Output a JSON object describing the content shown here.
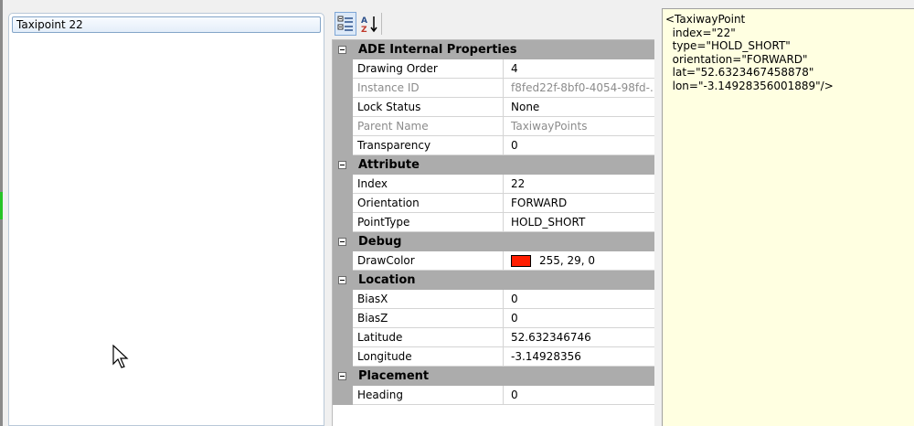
{
  "left_panel": {
    "selected_item": "Taxipoint 22"
  },
  "toolbar": {
    "categorized_icon": "categorized-icon",
    "alphabetical_icon": "sort-az-icon",
    "alpha_label_a": "A",
    "alpha_label_z": "Z"
  },
  "property_grid": {
    "categories": [
      {
        "name": "ADE Internal Properties",
        "rows": [
          {
            "key": "Drawing Order",
            "value": "4",
            "readonly": false
          },
          {
            "key": "Instance ID",
            "value": "f8fed22f-8bf0-4054-98fd-...",
            "readonly": true
          },
          {
            "key": "Lock Status",
            "value": "None",
            "readonly": false
          },
          {
            "key": "Parent Name",
            "value": "TaxiwayPoints",
            "readonly": true
          },
          {
            "key": "Transparency",
            "value": "0",
            "readonly": false
          }
        ]
      },
      {
        "name": "Attribute",
        "rows": [
          {
            "key": "Index",
            "value": "22",
            "readonly": false
          },
          {
            "key": "Orientation",
            "value": "FORWARD",
            "readonly": false
          },
          {
            "key": "PointType",
            "value": "HOLD_SHORT",
            "readonly": false
          }
        ]
      },
      {
        "name": "Debug",
        "rows": [
          {
            "key": "DrawColor",
            "value": "255, 29, 0",
            "readonly": false,
            "swatch": "#ff1d00"
          }
        ]
      },
      {
        "name": "Location",
        "rows": [
          {
            "key": "BiasX",
            "value": "0",
            "readonly": false
          },
          {
            "key": "BiasZ",
            "value": "0",
            "readonly": false
          },
          {
            "key": "Latitude",
            "value": "52.632346746",
            "readonly": false
          },
          {
            "key": "Longitude",
            "value": "-3.14928356",
            "readonly": false
          }
        ]
      },
      {
        "name": "Placement",
        "rows": [
          {
            "key": "Heading",
            "value": "0",
            "readonly": false
          }
        ]
      }
    ]
  },
  "xml_panel": {
    "lines": [
      "<TaxiwayPoint",
      "  index=\"22\"",
      "  type=\"HOLD_SHORT\"",
      "  orientation=\"FORWARD\"",
      "  lat=\"52.6323467458878\"",
      "  lon=\"-3.14928356001889\"/>"
    ]
  },
  "colors": {
    "category_bg": "#acacac",
    "xml_bg": "#ffffe1",
    "selection_border": "#84a5c8",
    "draw_color": "#ff1d00"
  }
}
